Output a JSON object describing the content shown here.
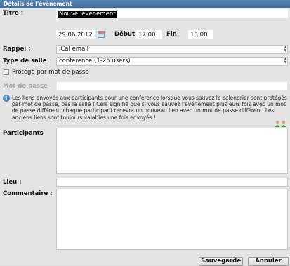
{
  "dialog": {
    "title": "Détails de l'événement"
  },
  "fields": {
    "title_label": "Titre :",
    "title_value": "Nouvel événement",
    "date_value": "29.06.2012",
    "start_label": "Début",
    "start_value": "17:00",
    "end_label": "Fin",
    "end_value": "18:00",
    "reminder_label": "Rappel :",
    "reminder_value": "iCal email",
    "room_type_label": "Type de salle",
    "room_type_value": "conference (1-25 users)",
    "password_protected_label": "Protégé par mot de passe",
    "password_label": "Mot de passe",
    "info_text": "Les liens envoyés aux participants pour une conférence lorsque vous sauvez le calendrier sont protégés par mot de passe, pas la salle ! Cela signifie que si vous sauvez l'événement plusieurs fois avec un mot de passe différent, chaque participant recevra un nouveau lien avec un mot de passe différent.  Les anciens liens sont toujours valables une fois envoyés !",
    "participants_label": "Participants",
    "location_label": "Lieu :",
    "location_value": "",
    "comment_label": "Commentaire :"
  },
  "buttons": {
    "save": "Sauvegarde",
    "cancel": "Annuler"
  },
  "icons": {
    "calendar": "calendar-icon",
    "info": "info-icon",
    "add_participants": "people-icon"
  }
}
